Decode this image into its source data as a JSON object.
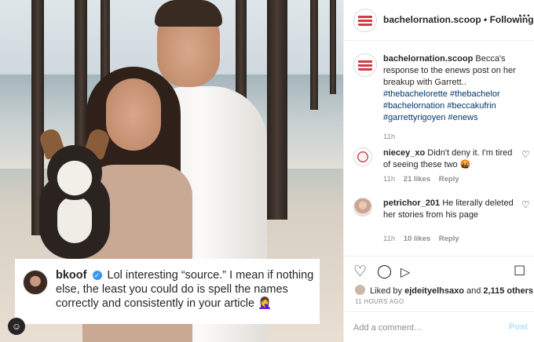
{
  "overlay_comment": {
    "username": "bkoof",
    "text": "Lol interesting “source.” I mean if nothing else, the least you could do is spell the names correctly and consistently in your article",
    "emoji": "🤦‍♀️"
  },
  "header": {
    "username": "bachelornation.scoop",
    "separator": "•",
    "follow_label": "Following",
    "menu_label": "···"
  },
  "caption": {
    "username": "bachelornation.scoop",
    "text": "Becca's response to the enews post on her breakup with Garrett..",
    "hashtags": "#thebachelorette #thebachelor #bachelornation #beccakufrin #garrettyrigoyen #enews",
    "time": "11h"
  },
  "comments": [
    {
      "username": "niecey_xo",
      "text": "Didn't deny it. I'm tired of seeing these two",
      "emoji": "🤬",
      "time": "11h",
      "likes": "21 likes",
      "reply": "Reply"
    },
    {
      "username": "petrichor_201",
      "text": "He literally deleted her stories from his page",
      "time": "11h",
      "likes": "10 likes",
      "reply": "Reply"
    }
  ],
  "actions": {
    "liked_prefix": "Liked by",
    "liked_user": "ejdeityelhsaxo",
    "liked_and": "and",
    "liked_count": "2,115 others",
    "time_ago": "11 HOURS AGO"
  },
  "add_comment": {
    "placeholder": "Add a comment…",
    "post_label": "Post"
  },
  "icons": {
    "heart": "♡",
    "comment": "◯",
    "share": "▷",
    "bookmark": "☐",
    "user_tag": "☺",
    "verified": "✓"
  }
}
